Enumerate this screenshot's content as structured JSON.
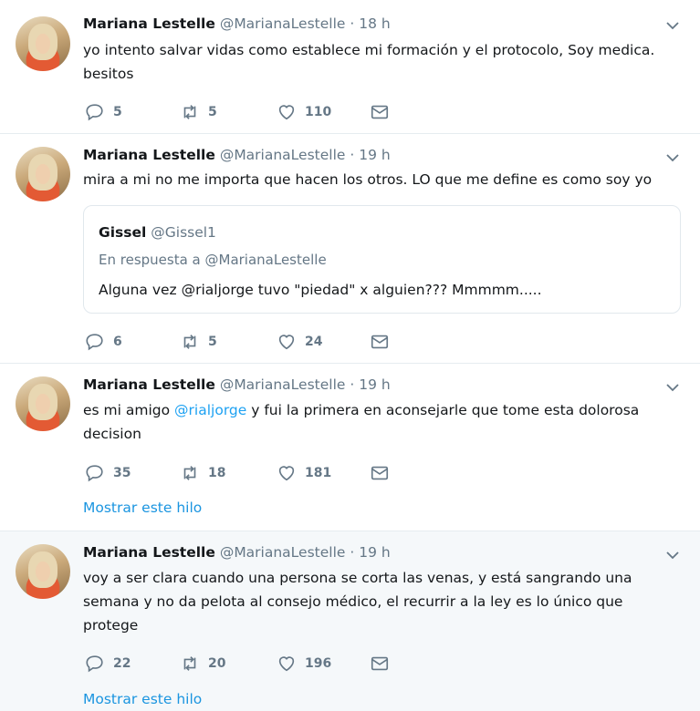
{
  "tweets": [
    {
      "name": "Mariana Lestelle",
      "handle": "@MarianaLestelle",
      "sep": "·",
      "time": "18 h",
      "text": "yo intento salvar vidas como establece mi formación y el protocolo, Soy medica. besitos",
      "replies": "5",
      "retweets": "5",
      "likes": "110"
    },
    {
      "name": "Mariana Lestelle",
      "handle": "@MarianaLestelle",
      "sep": "·",
      "time": "19 h",
      "text": "mira a mi no me importa que hacen los otros. LO que me define es como soy yo",
      "quote": {
        "name": "Gissel",
        "handle": "@Gissel1",
        "reply_to": "En respuesta a @MarianaLestelle",
        "text": "Alguna vez @rialjorge tuvo \"piedad\" x alguien??? Mmmmm....."
      },
      "replies": "6",
      "retweets": "5",
      "likes": "24"
    },
    {
      "name": "Mariana Lestelle",
      "handle": "@MarianaLestelle",
      "sep": "·",
      "time": "19 h",
      "text_pre": "es mi amigo",
      "text_mention": "@rialjorge",
      "text_post": "y fui la primera en aconsejarle que tome esta dolorosa decision",
      "replies": "35",
      "retweets": "18",
      "likes": "181",
      "thread_label": "Mostrar este hilo"
    },
    {
      "name": "Mariana Lestelle",
      "handle": "@MarianaLestelle",
      "sep": "·",
      "time": "19 h",
      "text": "voy a ser clara cuando una persona se corta las venas, y está sangrando una semana y no da pelota al consejo médico, el recurrir a la ley es lo único que protege",
      "replies": "22",
      "retweets": "20",
      "likes": "196",
      "thread_label": "Mostrar este hilo"
    }
  ],
  "colors": {
    "accent": "#1da1f2",
    "muted": "#657786",
    "text": "#14171a",
    "highlight_bg": "#f5f8fa"
  }
}
